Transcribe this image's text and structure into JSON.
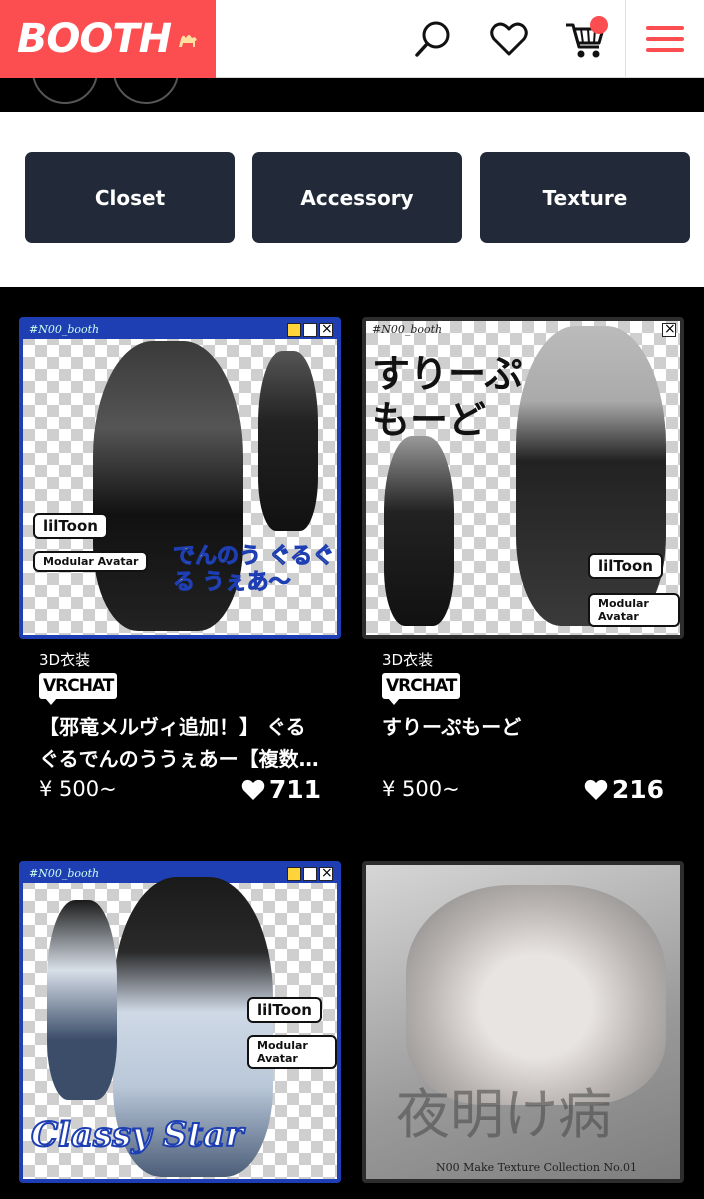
{
  "header": {
    "logo_text": "BOOTH",
    "icons": [
      "search-icon",
      "heart-icon",
      "cart-icon",
      "menu-icon"
    ],
    "brand_color": "#fc4d50"
  },
  "share": {
    "icons": [
      "x-icon",
      "mail-icon"
    ]
  },
  "categories": [
    {
      "label": "Closet"
    },
    {
      "label": "Accessory"
    },
    {
      "label": "Texture"
    }
  ],
  "products": [
    {
      "category": "3D衣装",
      "platform_badge": "VRCHAT",
      "title": "【邪竜メルヴィ追加！】 ぐるぐるでんのううぇあー【複数…",
      "price": "¥ 500~",
      "likes": "711",
      "thumb_handle": "#N00_booth",
      "thumb_art_text": "でんのう ぐるぐる うぇあ〜",
      "thumb_badges": [
        "lilToon",
        "Modular Avatar"
      ]
    },
    {
      "category": "3D衣装",
      "platform_badge": "VRCHAT",
      "title": "すりーぷもーど",
      "price": "¥ 500~",
      "likes": "216",
      "thumb_handle": "#N00_booth",
      "thumb_art_text": "すりーぷ もーど",
      "thumb_badges": [
        "lilToon",
        "Modular Avatar"
      ]
    },
    {
      "thumb_handle": "#N00_booth",
      "thumb_art_text": "Classy Star",
      "thumb_badges": [
        "lilToon",
        "Modular Avatar"
      ]
    },
    {
      "thumb_art_text": "夜明け病",
      "thumb_caption": "N00 Make Texture Collection No.01"
    }
  ]
}
